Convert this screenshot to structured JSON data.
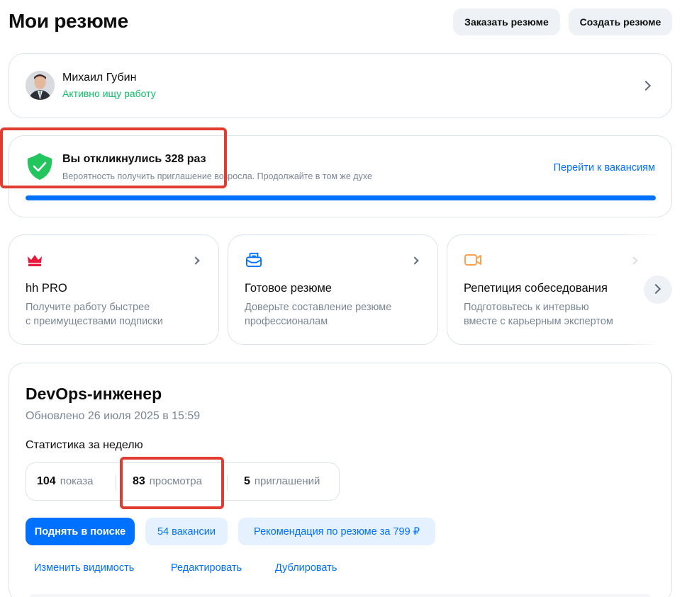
{
  "header": {
    "title": "Мои резюме",
    "order_button": "Заказать резюме",
    "create_button": "Создать резюме"
  },
  "profile": {
    "name": "Михаил Губин",
    "status": "Активно ищу работу",
    "status_color": "#0dc267"
  },
  "responses": {
    "title": "Вы откликнулись 328 раз",
    "subtitle": "Вероятность получить приглашение возросла. Продолжайте в том же духе",
    "link": "Перейти к вакансиям",
    "progress_fraction": 1.0
  },
  "services": [
    {
      "icon": "crown-icon",
      "title": "hh PRO",
      "desc1": "Получите работу быстрее",
      "desc2": "с преимуществами подписки"
    },
    {
      "icon": "mailbox-icon",
      "title": "Готовое резюме",
      "desc1": "Доверьте составление резюме",
      "desc2": "профессионалам"
    },
    {
      "icon": "video-camera-icon",
      "title": "Репетиция собеседования",
      "desc1": "Подготовьтесь к интервью",
      "desc2": "вместе с карьерным экспертом"
    }
  ],
  "resume": {
    "title": "DevOps-инженер",
    "updated": "Обновлено 26 июля 2025 в 15:59",
    "stats_label": "Статистика за неделю",
    "stats": [
      {
        "value": "104",
        "label": "показа"
      },
      {
        "value": "83",
        "label": "просмотра"
      },
      {
        "value": "5",
        "label": "приглашений"
      }
    ],
    "raise_button": "Поднять в поиске",
    "vacancies_button": "54 вакансии",
    "recommendation_button": "Рекомендация по резюме за 799 ₽",
    "links": [
      "Изменить видимость",
      "Редактировать",
      "Дублировать"
    ]
  },
  "colors": {
    "accent": "#0070ff",
    "highlight": "#e03c31",
    "success": "#0dc267"
  }
}
